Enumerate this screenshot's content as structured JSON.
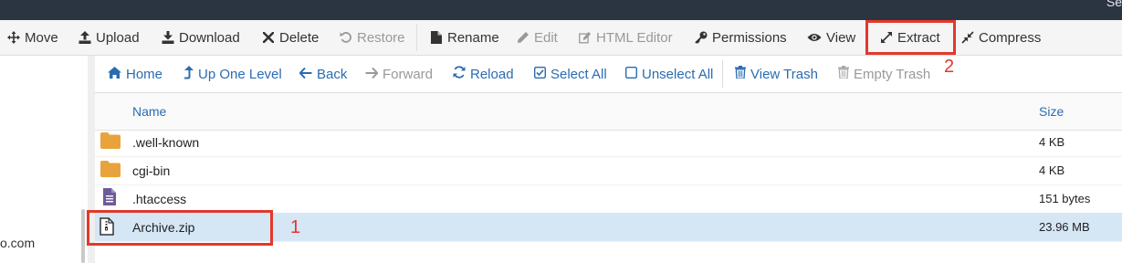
{
  "topbar": {
    "text": "Se"
  },
  "toolbar": {
    "items": [
      {
        "label": "Move",
        "icon": "move-icon"
      },
      {
        "label": "Upload",
        "icon": "upload-icon"
      },
      {
        "label": "Download",
        "icon": "download-icon"
      },
      {
        "label": "Delete",
        "icon": "close-icon"
      },
      {
        "label": "Restore",
        "icon": "restore-icon",
        "disabled": true
      },
      {
        "label": "Rename",
        "icon": "file-icon"
      },
      {
        "label": "Edit",
        "icon": "pencil-icon",
        "disabled": true
      },
      {
        "label": "HTML Editor",
        "icon": "edit-square-icon",
        "disabled": true
      },
      {
        "label": "Permissions",
        "icon": "key-icon"
      },
      {
        "label": "View",
        "icon": "eye-icon"
      },
      {
        "label": "Extract",
        "icon": "expand-icon"
      },
      {
        "label": "Compress",
        "icon": "compress-icon"
      }
    ]
  },
  "nav": {
    "items": [
      {
        "label": "Home",
        "icon": "home-icon"
      },
      {
        "label": "Up One Level",
        "icon": "level-up-icon"
      },
      {
        "label": "Back",
        "icon": "arrow-left-icon"
      },
      {
        "label": "Forward",
        "icon": "arrow-right-icon",
        "disabled": true
      },
      {
        "label": "Reload",
        "icon": "reload-icon"
      },
      {
        "label": "Select All",
        "icon": "checkbox-checked-icon"
      },
      {
        "label": "Unselect All",
        "icon": "checkbox-empty-icon"
      },
      {
        "label": "View Trash",
        "icon": "trash-icon"
      },
      {
        "label": "Empty Trash",
        "icon": "trash-icon",
        "disabled": true
      }
    ]
  },
  "table": {
    "columns": {
      "name": "Name",
      "size": "Size"
    },
    "rows": [
      {
        "name": ".well-known",
        "size": "4 KB",
        "type": "folder-icon"
      },
      {
        "name": "cgi-bin",
        "size": "4 KB",
        "type": "folder-icon"
      },
      {
        "name": ".htaccess",
        "size": "151 bytes",
        "type": "text-file-icon"
      },
      {
        "name": "Archive.zip",
        "size": "23.96 MB",
        "type": "zip-file-icon",
        "selected": true
      }
    ]
  },
  "left_panel": {
    "domain_fragment": "o.com"
  },
  "annotations": {
    "step1": "1",
    "step2": "2"
  },
  "colors": {
    "accent_link": "#2a6cb2",
    "highlight_red": "#e3382b",
    "selected_row": "#d5e6f5",
    "folder": "#e8a33c",
    "topbar": "#2b3441"
  }
}
